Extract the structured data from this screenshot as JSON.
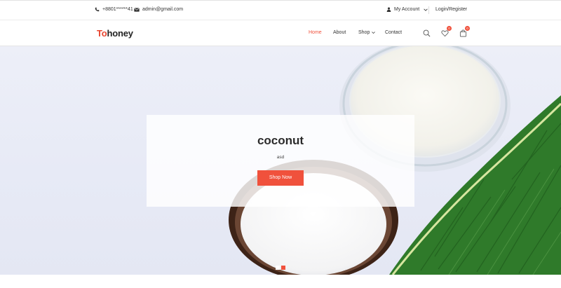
{
  "topbar": {
    "phone": "+8801******41",
    "email": "admin@gmail.com",
    "account_label": "My Account",
    "login_label": "Login/Register"
  },
  "header": {
    "logo_part1": "To",
    "logo_part2": "honey",
    "nav": [
      {
        "label": "Home",
        "active": true
      },
      {
        "label": "About",
        "active": false
      },
      {
        "label": "Shop",
        "active": false
      },
      {
        "label": "Contact",
        "active": false
      }
    ],
    "wishlist_count": "0",
    "cart_count": "0"
  },
  "hero": {
    "title": "coconut",
    "subtitle": "asd",
    "button_label": "Shop Now",
    "slides_total": 2,
    "slide_active": 2
  },
  "colors": {
    "accent": "#f0513c",
    "logo_red": "#e8442f",
    "hero_bg": "#e9ecf7"
  }
}
